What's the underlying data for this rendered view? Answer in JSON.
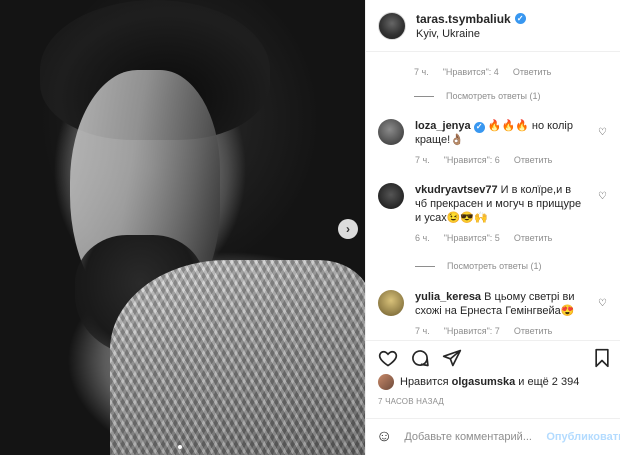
{
  "post": {
    "username": "taras.tsymbaliuk",
    "location": "Kyiv, Ukraine"
  },
  "comments_top": {
    "time": "7 ч.",
    "likes": "\"Нравится\": 4",
    "reply": "Ответить",
    "view_replies": "Посмотреть ответы (1)"
  },
  "comments": [
    {
      "user": "loza_jenya",
      "text": "🔥🔥🔥 но колір краще!👌🏽",
      "time": "7 ч.",
      "likes": "\"Нравится\": 6",
      "reply": "Ответить"
    },
    {
      "user": "vkudryavtsev77",
      "text": "И в колїре,и в чб прекрасен и могуч в прищуре и усах😉😎🙌",
      "time": "6 ч.",
      "likes": "\"Нравится\": 5",
      "reply": "Ответить",
      "view_replies": "Посмотреть ответы (1)"
    },
    {
      "user": "yulia_keresa",
      "text": "В цьому светрі ви схожі на Ернеста Гемінгвейа😍",
      "time": "7 ч.",
      "likes": "\"Нравится\": 7",
      "reply": "Ответить"
    }
  ],
  "likes": {
    "prefix": "Нравится",
    "user": "olgasumska",
    "suffix": "и ещё 2 394"
  },
  "time_ago": "7 ЧАСОВ НАЗАД",
  "add_comment": {
    "placeholder": "Добавьте комментарий...",
    "publish": "Опубликовать"
  },
  "icons": {
    "verified": "verified-badge-icon",
    "heart": "heart-icon",
    "comment": "comment-icon",
    "share": "share-icon",
    "save": "bookmark-icon",
    "emoji": "smile-icon",
    "next": "chevron-right-icon"
  },
  "colors": {
    "verified": "#3897f0",
    "publish_disabled": "#b3dbff",
    "muted_text": "#8e8e8e"
  }
}
